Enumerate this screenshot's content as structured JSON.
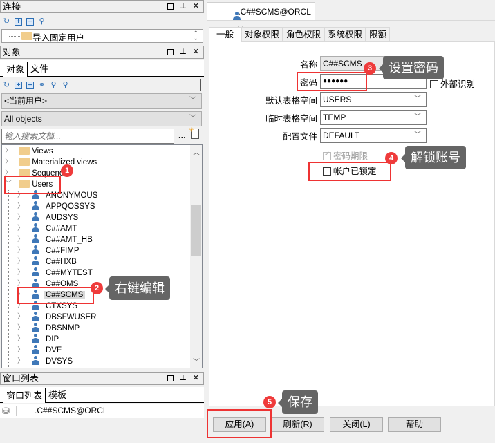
{
  "connection_panel": {
    "title": "连接",
    "tree_item": "导入固定用户"
  },
  "objects_panel": {
    "title": "对象",
    "tabs": [
      "对象",
      "文件"
    ],
    "schema_select": "<当前用户>",
    "filter_select": "All objects",
    "search_placeholder": "输入搜索文档...",
    "search_more": "...",
    "folders": [
      "Views",
      "Materialized views",
      "Sequences",
      "Users"
    ],
    "users": [
      "ANONYMOUS",
      "APPQOSSYS",
      "AUDSYS",
      "C##AMT",
      "C##AMT_HB",
      "C##FIMP",
      "C##HXB",
      "C##MYTEST",
      "C##OMS",
      "C##SCMS",
      "CTXSYS",
      "DBSFWUSER",
      "DBSNMP",
      "DIP",
      "DVF",
      "DVSYS"
    ],
    "selected_user": "C##SCMS"
  },
  "window_list_panel": {
    "title": "窗口列表",
    "tabs": [
      "窗口列表",
      "模板"
    ],
    "item": ".C##SCMS@ORCL"
  },
  "editor": {
    "doc_tab": ".C##SCMS@ORCL",
    "tabs": [
      "一般",
      "对象权限",
      "角色权限",
      "系统权限",
      "限额"
    ],
    "fields": {
      "name_label": "名称",
      "name_value": "C##SCMS",
      "password_label": "密码",
      "password_value": "●●●●●●",
      "external_label": "外部识别",
      "default_ts_label": "默认表格空间",
      "default_ts_value": "USERS",
      "temp_ts_label": "临时表格空间",
      "temp_ts_value": "TEMP",
      "profile_label": "配置文件",
      "profile_value": "DEFAULT",
      "pwd_expire_label": "密码期限",
      "locked_label": "帐户已锁定"
    },
    "buttons": {
      "apply": "应用(A)",
      "refresh": "刷新(R)",
      "close": "关闭(L)",
      "help": "帮助"
    }
  },
  "annotations": [
    {
      "n": "1",
      "text": ""
    },
    {
      "n": "2",
      "text": "右键编辑"
    },
    {
      "n": "3",
      "text": "设置密码"
    },
    {
      "n": "4",
      "text": "解锁账号"
    },
    {
      "n": "5",
      "text": "保存"
    }
  ],
  "colors": {
    "annotation_red": "#ef3b3b",
    "tooltip_gray": "#656565",
    "user_icon_blue": "#3f78b8"
  }
}
